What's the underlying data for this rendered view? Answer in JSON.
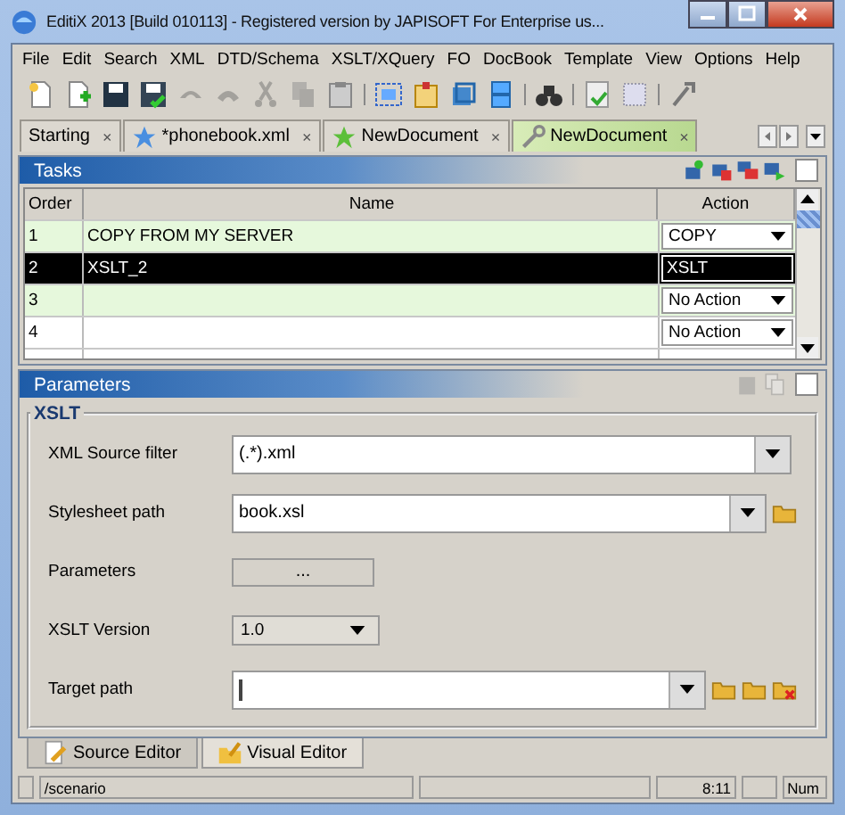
{
  "window": {
    "title": "EditiX 2013 [Build 010113] - Registered version by JAPISOFT For Enterprise us..."
  },
  "menu": [
    "File",
    "Edit",
    "Search",
    "XML",
    "DTD/Schema",
    "XSLT/XQuery",
    "FO",
    "DocBook",
    "Template",
    "View",
    "Options",
    "Help"
  ],
  "toolbar": [
    {
      "disabled": false
    },
    {
      "disabled": false
    },
    {
      "disabled": false
    },
    {
      "disabled": false
    },
    {
      "disabled": true
    },
    {
      "disabled": true
    },
    {
      "disabled": true
    },
    {
      "disabled": true
    },
    {
      "disabled": false
    },
    {
      "disabled": false
    },
    {
      "disabled": false
    },
    {
      "disabled": false
    },
    {
      "disabled": false
    },
    {
      "disabled": false
    },
    {
      "disabled": false
    },
    {
      "disabled": false
    },
    {
      "disabled": false
    }
  ],
  "tabs": [
    {
      "label": "Starting",
      "close": "×",
      "selected": false
    },
    {
      "label": "*phonebook.xml",
      "close": "×",
      "selected": false
    },
    {
      "label": "NewDocument",
      "close": "×",
      "selected": false
    },
    {
      "label": "NewDocument",
      "close": "×",
      "selected": true
    }
  ],
  "tasks": {
    "title": "Tasks",
    "columns": [
      "Order",
      "Name",
      "Action"
    ],
    "rows": [
      {
        "order": "1",
        "name": "COPY FROM MY SERVER",
        "action": "COPY",
        "selected": false
      },
      {
        "order": "2",
        "name": "XSLT_2",
        "action": "XSLT",
        "selected": true
      },
      {
        "order": "3",
        "action": "No Action",
        "selected": false
      },
      {
        "order": "4",
        "action": "No Action",
        "selected": false
      }
    ]
  },
  "parameters": {
    "title": "Parameters",
    "group": "XSLT",
    "fields": [
      {
        "label": "XML Source filter",
        "kind": "combo",
        "value": "(.*).xml"
      },
      {
        "label": "Stylesheet path",
        "kind": "path",
        "value": "book.xsl"
      },
      {
        "label": "Parameters",
        "kind": "button",
        "value": "..."
      },
      {
        "label": "XSLT Version",
        "kind": "small-combo",
        "value": "1.0"
      },
      {
        "label": "Target path",
        "kind": "target"
      }
    ]
  },
  "editor_tabs": [
    {
      "label": "Source Editor",
      "selected": false
    },
    {
      "label": "Visual Editor",
      "selected": true
    }
  ],
  "status_bar": {
    "path": "/scenario",
    "position": "8:11",
    "mode": "Num"
  }
}
